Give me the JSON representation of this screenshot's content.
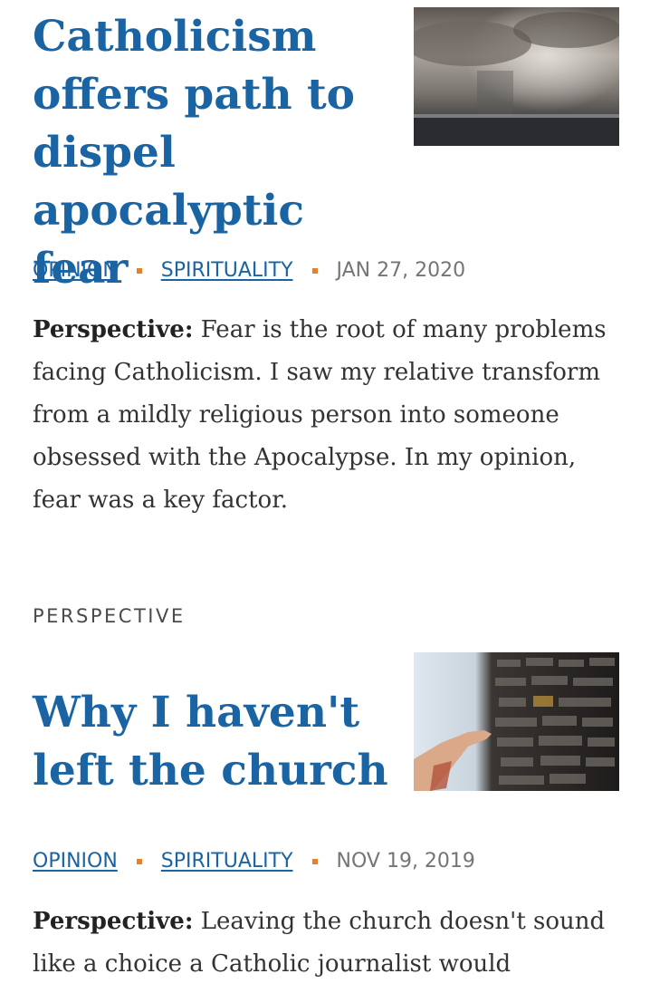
{
  "articles": [
    {
      "headline": "Catholicism offers path to dispel apocalyptic fear",
      "image_icon": "storm-clouds-photo",
      "category1": "OPINION",
      "category2": "SPIRITUALITY",
      "date": "JAN 27, 2020",
      "teaser_prefix": "Perspective:",
      "teaser": "Fear is the root of many problems facing Catholicism. I saw my relative transform from a mildly religious person into someone obsessed with the Apocalypse. In my opinion, fear was a key factor."
    },
    {
      "eyebrow": "PERSPECTIVE",
      "headline": "Why I haven't left the church",
      "image_icon": "hand-touching-door-photo",
      "category1": "OPINION",
      "category2": "SPIRITUALITY",
      "date": "NOV 19, 2019",
      "teaser_prefix": "Perspective:",
      "teaser": "Leaving the church doesn't sound like a choice a Catholic journalist would"
    }
  ],
  "colors": {
    "link": "#1a64a3",
    "separator": "#e8802a",
    "date": "#757575"
  }
}
